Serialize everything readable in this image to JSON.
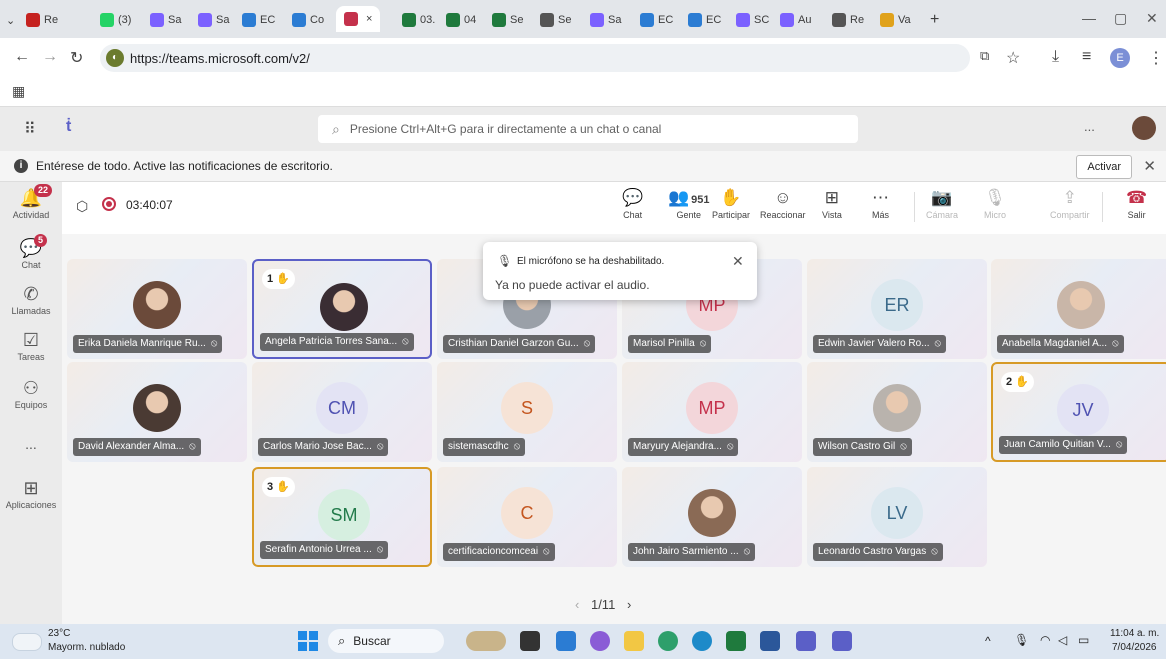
{
  "browser": {
    "tabs": [
      {
        "label": "Re",
        "color": "#c5221f"
      },
      {
        "label": "(3)",
        "color": "#25d366"
      },
      {
        "label": "Sa",
        "color": "#7b61ff"
      },
      {
        "label": "Sa",
        "color": "#7b61ff"
      },
      {
        "label": "EC",
        "color": "#2b7cd3"
      },
      {
        "label": "Co",
        "color": "#2b7cd3"
      },
      {
        "label": "",
        "color": "#c4314b"
      },
      {
        "label": "03.",
        "color": "#1f7a3d"
      },
      {
        "label": "04",
        "color": "#1f7a3d"
      },
      {
        "label": "Se",
        "color": "#1f7a3d"
      },
      {
        "label": "Se",
        "color": "#555555"
      },
      {
        "label": "Sa",
        "color": "#7b61ff"
      },
      {
        "label": "EC",
        "color": "#2b7cd3"
      },
      {
        "label": "EC",
        "color": "#2b7cd3"
      },
      {
        "label": "SC",
        "color": "#7b61ff"
      },
      {
        "label": "Au",
        "color": "#7b61ff"
      },
      {
        "label": "Re",
        "color": "#555555"
      },
      {
        "label": "Va",
        "color": "#e0a21b"
      }
    ],
    "active_tab_close": "×",
    "new_tab": "+",
    "url": "https://teams.microsoft.com/v2/",
    "profile_initial": "E"
  },
  "teams": {
    "search_placeholder": "Presione Ctrl+Alt+G para ir directamente a un chat o canal",
    "more": "...",
    "notification": {
      "text": "Entérese de todo. Active las notificaciones de escritorio.",
      "button": "Activar"
    },
    "rail": [
      {
        "label": "Actividad",
        "icon": "bell-icon",
        "badge": "22"
      },
      {
        "label": "Chat",
        "icon": "chat-icon",
        "badge": "5"
      },
      {
        "label": "Llamadas",
        "icon": "phone-icon",
        "badge": ""
      },
      {
        "label": "Tareas",
        "icon": "tasks-icon",
        "badge": ""
      },
      {
        "label": "Equipos",
        "icon": "teams-icon",
        "badge": ""
      },
      {
        "label": "...",
        "icon": "more-icon",
        "badge": ""
      },
      {
        "label": "Aplicaciones",
        "icon": "apps-icon",
        "badge": ""
      }
    ],
    "meeting": {
      "timer": "03:40:07",
      "participants_count": "951",
      "toolbar": [
        {
          "label": "Chat"
        },
        {
          "label": "Gente"
        },
        {
          "label": "Participar"
        },
        {
          "label": "Reaccionar"
        },
        {
          "label": "Vista"
        },
        {
          "label": "Más"
        },
        {
          "label": "Cámara"
        },
        {
          "label": "Micro"
        },
        {
          "label": "Compartir"
        },
        {
          "label": "Salir"
        }
      ]
    },
    "popup": {
      "title": "El micrófono se ha deshabilitado.",
      "body": "Ya no puede activar el audio."
    },
    "tiles": [
      {
        "name": "Erika Daniela Manrique Ru...",
        "kind": "photo",
        "photo_color": "#6b4a3a",
        "hand": ""
      },
      {
        "name": "Angela Patricia Torres Sana...",
        "kind": "photo",
        "photo_color": "#3a2d33",
        "hand": "1"
      },
      {
        "name": "Cristhian Daniel Garzon Gu...",
        "kind": "photo",
        "photo_color": "#9aa0a8",
        "hand": ""
      },
      {
        "name": "Marisol Pinilla",
        "kind": "initials",
        "initials": "MP",
        "initials_color": "#c4314b",
        "bg": "#f3d6da",
        "hand": ""
      },
      {
        "name": "Edwin Javier Valero Ro...",
        "kind": "initials",
        "initials": "ER",
        "initials_color": "#3b6a8a",
        "bg": "#dbe8ef",
        "hand": ""
      },
      {
        "name": "Anabella Magdaniel A...",
        "kind": "photo",
        "photo_color": "#c9b6a8",
        "hand": ""
      },
      {
        "name": "David Alexander Alma...",
        "kind": "photo",
        "photo_color": "#4a3a33",
        "hand": ""
      },
      {
        "name": "Carlos Mario Jose Bac...",
        "kind": "initials",
        "initials": "CM",
        "initials_color": "#4f52b2",
        "bg": "#e3e3f4",
        "hand": ""
      },
      {
        "name": "sistemascdhc",
        "kind": "initials",
        "initials": "S",
        "initials_color": "#c4561f",
        "bg": "#f6e3d6",
        "hand": ""
      },
      {
        "name": "Maryury Alejandra...",
        "kind": "initials",
        "initials": "MP",
        "initials_color": "#c4314b",
        "bg": "#f3d6da",
        "hand": ""
      },
      {
        "name": "Wilson Castro Gil",
        "kind": "photo",
        "photo_color": "#b9b3ad",
        "hand": ""
      },
      {
        "name": "Juan Camilo Quitian V...",
        "kind": "initials",
        "initials": "JV",
        "initials_color": "#4f52b2",
        "bg": "#e3e3f4",
        "hand": "2"
      },
      {
        "name": "Serafin Antonio Urrea ...",
        "kind": "initials",
        "initials": "SM",
        "initials_color": "#237b4b",
        "bg": "#d6efe0",
        "hand": "3"
      },
      {
        "name": "certificacioncomceai",
        "kind": "initials",
        "initials": "C",
        "initials_color": "#c4561f",
        "bg": "#f6e3d6",
        "hand": ""
      },
      {
        "name": "John Jairo Sarmiento ...",
        "kind": "photo",
        "photo_color": "#8a6a55",
        "hand": ""
      },
      {
        "name": "Leonardo Castro Vargas",
        "kind": "initials",
        "initials": "LV",
        "initials_color": "#3b6a8a",
        "bg": "#dbe8ef",
        "hand": ""
      }
    ],
    "pager": "1/11"
  },
  "taskbar": {
    "weather_temp": "23°C",
    "weather_desc": "Mayorm. nublado",
    "search": "Buscar",
    "time": "11:04 a. m.",
    "date": "7/04/2026"
  }
}
